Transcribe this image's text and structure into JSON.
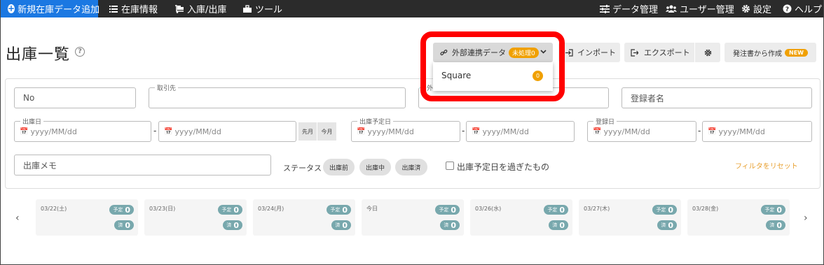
{
  "nav": {
    "add_new": "新規在庫データ追加",
    "stock_info": "在庫情報",
    "inout": "入庫/出庫",
    "tools": "ツール",
    "data_management": "データ管理",
    "user_management": "ユーザー管理",
    "settings": "設定",
    "help": "ヘルプ"
  },
  "page": {
    "title": "出庫一覧",
    "help_icon": "?"
  },
  "toolbar": {
    "external_data": "外部連携データ",
    "unprocessed_badge": "未処理0",
    "import": "インポート",
    "export": "エクスポート",
    "create_from_order": "発注書から作成",
    "new_badge": "NEW"
  },
  "dropdown": {
    "item": "Square",
    "count": "0"
  },
  "filters": {
    "no_placeholder": "No",
    "partner_label": "取引先",
    "hidden_field_label": "外部連携日",
    "registrant_placeholder": "登録者名",
    "ship_date_label": "出庫日",
    "planned_date_label": "出庫予定日",
    "registered_label": "登録日",
    "date_placeholder": "yyyy/MM/dd",
    "dash": "-",
    "last_month": "先月",
    "this_month": "今月",
    "memo_placeholder": "出庫メモ",
    "status_label": "ステータス",
    "status_chips": [
      "出庫前",
      "出庫中",
      "出庫済"
    ],
    "overdue_label": "出庫予定日を過ぎたもの",
    "reset": "フィルタをリセット"
  },
  "calendar": {
    "prev": "‹",
    "next": "›",
    "planned_label": "予定",
    "done_label": "済",
    "days": [
      {
        "date": "03/22(土)",
        "planned": "0",
        "done": "0"
      },
      {
        "date": "03/23(日)",
        "planned": "0",
        "done": "0"
      },
      {
        "date": "03/24(月)",
        "planned": "0",
        "done": "0"
      },
      {
        "date": "今日",
        "planned": "0",
        "done": "0"
      },
      {
        "date": "03/26(水)",
        "planned": "0",
        "done": "0"
      },
      {
        "date": "03/27(木)",
        "planned": "0",
        "done": "0"
      },
      {
        "date": "03/28(金)",
        "planned": "0",
        "done": "0"
      }
    ]
  },
  "colors": {
    "nav_bg": "#2b2b2b",
    "primary": "#1b78e2",
    "accent": "#f0a000",
    "pill": "#78a8ad",
    "highlight": "#ff0000"
  }
}
